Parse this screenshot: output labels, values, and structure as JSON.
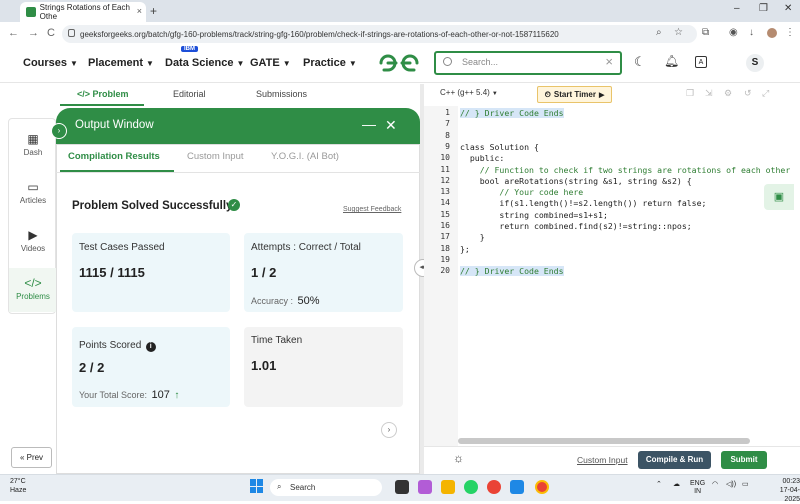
{
  "browser": {
    "tab_title": "Strings Rotations of Each Othe",
    "tab_close": "×",
    "new_tab": "+",
    "url": "geeksforgeeks.org/batch/gfg-160-problems/track/string-gfg-160/problem/check-if-strings-are-rotations-of-each-other-or-not-1587115620",
    "back": "←",
    "forward": "→",
    "reload": "C",
    "window_controls": [
      "–",
      "❐",
      "✕"
    ]
  },
  "header": {
    "nav": [
      "Courses",
      "Placement",
      "Data Science",
      "GATE",
      "Practice"
    ],
    "ibm_badge": "IBM",
    "search_placeholder": "Search...",
    "avatar_letter": "S",
    "logo_text": "GG"
  },
  "rail": {
    "items": [
      {
        "label": "Dash",
        "icon": "grid-icon",
        "glyph": "▦"
      },
      {
        "label": "Articles",
        "icon": "book-icon",
        "glyph": "▭"
      },
      {
        "label": "Videos",
        "icon": "video-icon",
        "glyph": "▶"
      },
      {
        "label": "Problems",
        "icon": "code-icon",
        "glyph": "</>"
      }
    ],
    "prev_label": "« Prev"
  },
  "problem_tabs": [
    "</> Problem",
    "Editorial",
    "Submissions"
  ],
  "output_window": {
    "title": "Output Window",
    "subtabs": [
      "Compilation Results",
      "Custom Input",
      "Y.O.G.I. (AI Bot)"
    ],
    "status": "Problem Solved Successfully",
    "suggest_feedback": "Suggest Feedback",
    "cards": {
      "test_cases": {
        "label": "Test Cases Passed",
        "value": "1115 / 1115"
      },
      "attempts": {
        "label": "Attempts : Correct / Total",
        "value": "1 / 2",
        "sub_label": "Accuracy :",
        "sub_value": "50%"
      },
      "points": {
        "label": "Points Scored",
        "value": "2 / 2",
        "sub_label": "Your Total Score:",
        "sub_value": "107"
      },
      "time": {
        "label": "Time Taken",
        "value": "1.01"
      }
    }
  },
  "editor": {
    "language": "C++ (g++ 5.4)",
    "timer_label": "Start Timer",
    "lines": [
      {
        "n": "1",
        "text": "// } Driver Code Ends"
      },
      {
        "n": "7",
        "text": ""
      },
      {
        "n": "8",
        "text": ""
      },
      {
        "n": "9",
        "text": "class Solution {"
      },
      {
        "n": "10",
        "text": "  public:"
      },
      {
        "n": "11",
        "text": "    // Function to check if two strings are rotations of each other"
      },
      {
        "n": "12",
        "text": "    bool areRotations(string &s1, string &s2) {"
      },
      {
        "n": "13",
        "text": "        // Your code here"
      },
      {
        "n": "14",
        "text": "        if(s1.length()!=s2.length()) return false;"
      },
      {
        "n": "15",
        "text": "        string combined=s1+s1;"
      },
      {
        "n": "16",
        "text": "        return combined.find(s2)!=string::npos;"
      },
      {
        "n": "17",
        "text": "    }"
      },
      {
        "n": "18",
        "text": "};"
      },
      {
        "n": "19",
        "text": ""
      },
      {
        "n": "20",
        "text": "// } Driver Code Ends"
      }
    ],
    "custom_input": "Custom Input",
    "compile_run": "Compile & Run",
    "submit": "Submit"
  },
  "taskbar": {
    "temp": "27°C",
    "weather": "Haze",
    "search_label": "Search",
    "lang_top": "ENG",
    "lang_bottom": "IN",
    "time": "00:23",
    "date": "17-04-2025"
  },
  "colors": {
    "brand": "#2f8d46",
    "card": "#edf7fa",
    "run": "#3c5465"
  }
}
